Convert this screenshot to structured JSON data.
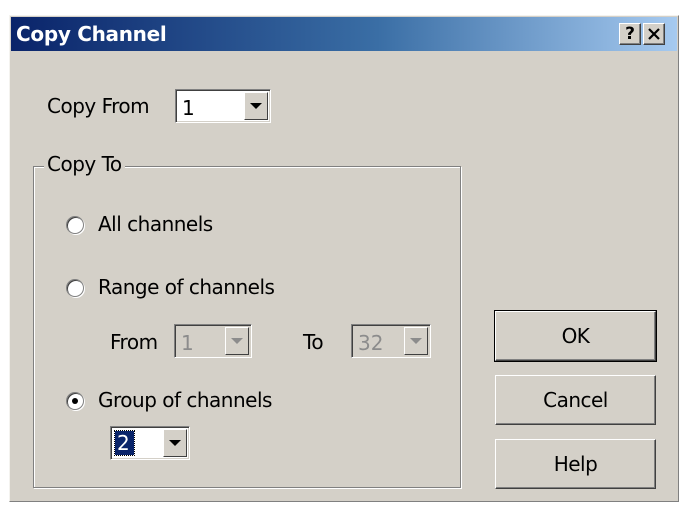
{
  "window": {
    "title": "Copy Channel",
    "help_button": "?",
    "close_button": "✕"
  },
  "copy_from": {
    "label": "Copy From",
    "value": "1"
  },
  "copy_to": {
    "group_label": "Copy To",
    "all_channels": {
      "label": "All channels",
      "checked": false
    },
    "range_of_channels": {
      "label": "Range of channels",
      "checked": false,
      "from_label": "From",
      "from_value": "1",
      "to_label": "To",
      "to_value": "32"
    },
    "group_of_channels": {
      "label": "Group of channels",
      "checked": true,
      "value": "2"
    }
  },
  "buttons": {
    "ok": "OK",
    "cancel": "Cancel",
    "help": "Help"
  }
}
